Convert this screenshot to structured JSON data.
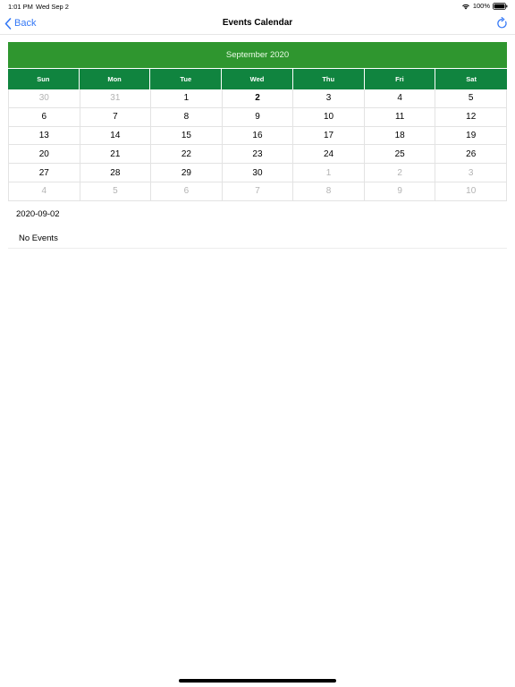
{
  "status_bar": {
    "time": "1:01 PM",
    "date": "Wed Sep 2",
    "battery": "100%",
    "icons": [
      "wifi-icon",
      "battery-icon"
    ]
  },
  "nav": {
    "back_label": "Back",
    "title": "Events Calendar",
    "back_icon": "chevron-left-icon",
    "refresh_icon": "refresh-icon",
    "accent_color": "#3478f6"
  },
  "calendar": {
    "month_label": "September 2020",
    "header_color": "#2f962f",
    "weekday_color": "#10843f",
    "weekdays": [
      "Sun",
      "Mon",
      "Tue",
      "Wed",
      "Thu",
      "Fri",
      "Sat"
    ],
    "weeks": [
      [
        {
          "d": "30",
          "m": true
        },
        {
          "d": "31",
          "m": true
        },
        {
          "d": "1"
        },
        {
          "d": "2",
          "today": true
        },
        {
          "d": "3"
        },
        {
          "d": "4"
        },
        {
          "d": "5"
        }
      ],
      [
        {
          "d": "6"
        },
        {
          "d": "7"
        },
        {
          "d": "8"
        },
        {
          "d": "9"
        },
        {
          "d": "10"
        },
        {
          "d": "11"
        },
        {
          "d": "12"
        }
      ],
      [
        {
          "d": "13"
        },
        {
          "d": "14"
        },
        {
          "d": "15"
        },
        {
          "d": "16"
        },
        {
          "d": "17"
        },
        {
          "d": "18"
        },
        {
          "d": "19"
        }
      ],
      [
        {
          "d": "20"
        },
        {
          "d": "21"
        },
        {
          "d": "22"
        },
        {
          "d": "23"
        },
        {
          "d": "24"
        },
        {
          "d": "25"
        },
        {
          "d": "26"
        }
      ],
      [
        {
          "d": "27"
        },
        {
          "d": "28"
        },
        {
          "d": "29"
        },
        {
          "d": "30"
        },
        {
          "d": "1",
          "m": true
        },
        {
          "d": "2",
          "m": true
        },
        {
          "d": "3",
          "m": true
        }
      ],
      [
        {
          "d": "4",
          "m": true
        },
        {
          "d": "5",
          "m": true
        },
        {
          "d": "6",
          "m": true
        },
        {
          "d": "7",
          "m": true
        },
        {
          "d": "8",
          "m": true
        },
        {
          "d": "9",
          "m": true
        },
        {
          "d": "10",
          "m": true
        }
      ]
    ]
  },
  "selected_date": "2020-09-02",
  "events": {
    "empty_label": "No Events"
  }
}
